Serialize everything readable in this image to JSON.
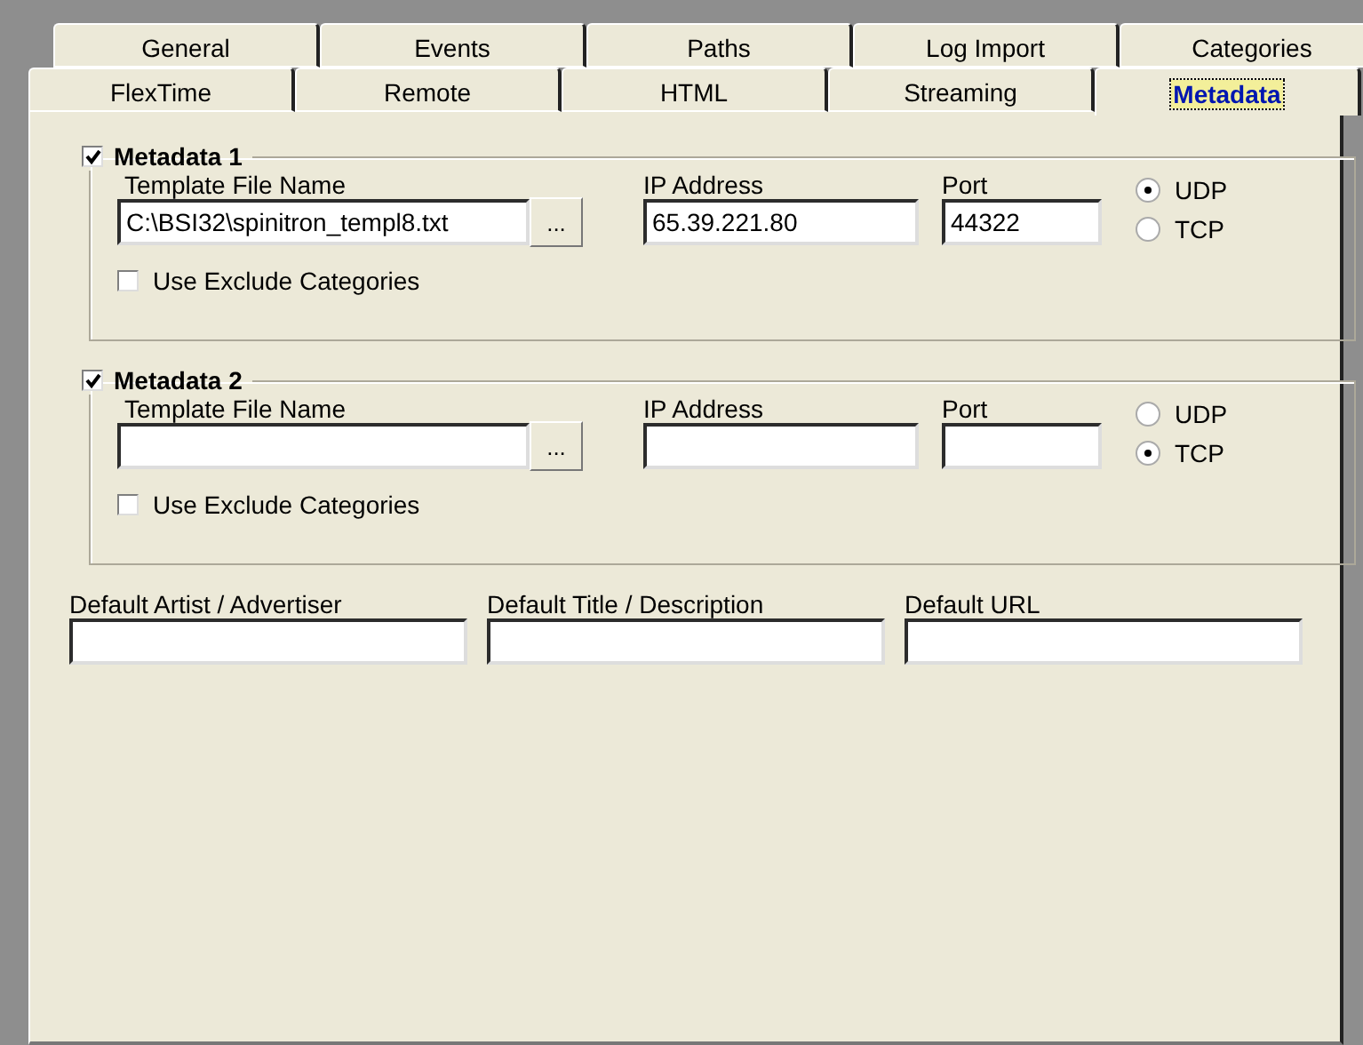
{
  "tab_rows": [
    {
      "tabs": [
        {
          "label": "General",
          "selected": false
        },
        {
          "label": "Events",
          "selected": false
        },
        {
          "label": "Paths",
          "selected": false
        },
        {
          "label": "Log Import",
          "selected": false
        },
        {
          "label": "Categories",
          "selected": false
        }
      ]
    },
    {
      "tabs": [
        {
          "label": "FlexTime",
          "selected": false
        },
        {
          "label": "Remote",
          "selected": false
        },
        {
          "label": "HTML",
          "selected": false
        },
        {
          "label": "Streaming",
          "selected": false
        },
        {
          "label": "Metadata",
          "selected": true
        }
      ]
    }
  ],
  "groups": [
    {
      "title": "Metadata 1",
      "checked": true,
      "template_label": "Template File Name",
      "template_value": "C:\\BSI32\\spinitron_templ8.txt",
      "browse": "...",
      "ip_label": "IP Address",
      "ip_value": "65.39.221.80",
      "port_label": "Port",
      "port_value": "44322",
      "protocols": [
        {
          "label": "UDP",
          "selected": true
        },
        {
          "label": "TCP",
          "selected": false
        }
      ],
      "exclude": {
        "label": "Use Exclude Categories",
        "checked": false
      }
    },
    {
      "title": "Metadata 2",
      "checked": true,
      "template_label": "Template File Name",
      "browse": "...",
      "ip_label": "IP Address",
      "port_label": "Port",
      "protocols": [
        {
          "label": "UDP",
          "selected": false
        },
        {
          "label": "TCP",
          "selected": true
        }
      ],
      "exclude": {
        "label": "Use Exclude Categories",
        "checked": false
      }
    }
  ],
  "defaults": [
    {
      "label": "Default Artist / Advertiser"
    },
    {
      "label": "Default Title / Description"
    },
    {
      "label": "Default URL"
    }
  ]
}
